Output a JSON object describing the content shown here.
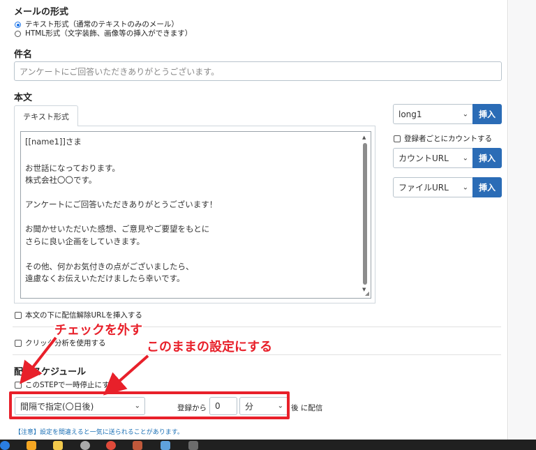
{
  "format": {
    "title": "メールの形式",
    "options": [
      {
        "label": "テキスト形式（通常のテキストのみのメール）",
        "selected": true
      },
      {
        "label": "HTML形式（文字装飾、画像等の挿入ができます）",
        "selected": false
      }
    ]
  },
  "subject": {
    "title": "件名",
    "value": "アンケートにご回答いただきありがとうございます。"
  },
  "body": {
    "title": "本文",
    "tab": "テキスト形式",
    "lines": [
      "[[name1]]さま",
      "お世話になっております。",
      "株式会社〇〇です。",
      "アンケートにご回答いただきありがとうございます！",
      "お聞かせいただいた感想、ご意見やご要望をもとに",
      "さらに良い企画をしていきます。",
      "その他、何かお気付きの点がございましたら、",
      "遠慮なくお伝えいただけましたら幸いです。"
    ]
  },
  "side": {
    "field_select": "long1",
    "insert_label": "挿入",
    "count_per_subscriber": "登録者ごとにカウントする",
    "count_url_select": "カウントURL",
    "file_url_select": "ファイルURL"
  },
  "options": {
    "unsubscribe_url": "本文の下に配信解除URLを挿入する",
    "click_analysis": "クリック分析を使用する"
  },
  "schedule": {
    "title": "配信スケジュール",
    "pause_step": "このSTEPで一時停止にする",
    "timing_select": "間隔で指定(〇日後)",
    "from_label": "登録から",
    "amount_value": "0",
    "unit_select": "分",
    "after_label": "後 に配信"
  },
  "annotations": {
    "uncheck": "チェックを外す",
    "keep_setting": "このままの設定にする",
    "accent_color": "#e8202a"
  },
  "warning_note": "【注意】設定を間違えると一気に送られることがあります。"
}
